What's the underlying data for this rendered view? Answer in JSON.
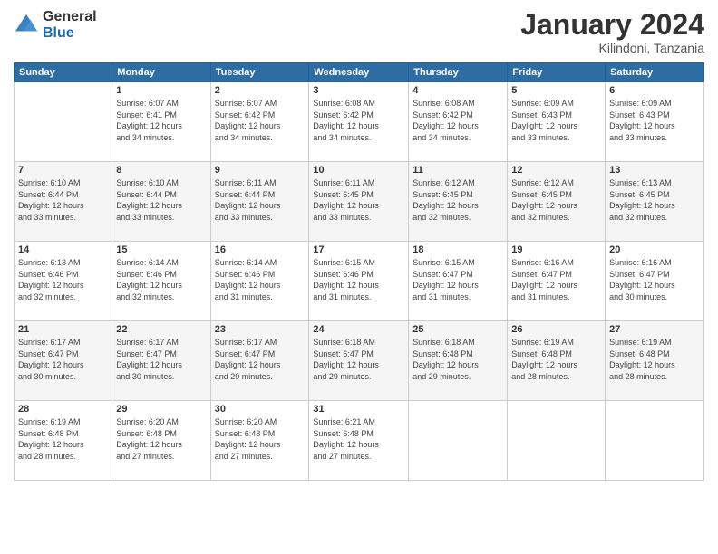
{
  "header": {
    "logo": {
      "general": "General",
      "blue": "Blue"
    },
    "title": "January 2024",
    "subtitle": "Kilindoni, Tanzania"
  },
  "days_of_week": [
    "Sunday",
    "Monday",
    "Tuesday",
    "Wednesday",
    "Thursday",
    "Friday",
    "Saturday"
  ],
  "weeks": [
    [
      {
        "day": "",
        "info": ""
      },
      {
        "day": "1",
        "info": "Sunrise: 6:07 AM\nSunset: 6:41 PM\nDaylight: 12 hours\nand 34 minutes."
      },
      {
        "day": "2",
        "info": "Sunrise: 6:07 AM\nSunset: 6:42 PM\nDaylight: 12 hours\nand 34 minutes."
      },
      {
        "day": "3",
        "info": "Sunrise: 6:08 AM\nSunset: 6:42 PM\nDaylight: 12 hours\nand 34 minutes."
      },
      {
        "day": "4",
        "info": "Sunrise: 6:08 AM\nSunset: 6:42 PM\nDaylight: 12 hours\nand 34 minutes."
      },
      {
        "day": "5",
        "info": "Sunrise: 6:09 AM\nSunset: 6:43 PM\nDaylight: 12 hours\nand 33 minutes."
      },
      {
        "day": "6",
        "info": "Sunrise: 6:09 AM\nSunset: 6:43 PM\nDaylight: 12 hours\nand 33 minutes."
      }
    ],
    [
      {
        "day": "7",
        "info": "Sunrise: 6:10 AM\nSunset: 6:44 PM\nDaylight: 12 hours\nand 33 minutes."
      },
      {
        "day": "8",
        "info": "Sunrise: 6:10 AM\nSunset: 6:44 PM\nDaylight: 12 hours\nand 33 minutes."
      },
      {
        "day": "9",
        "info": "Sunrise: 6:11 AM\nSunset: 6:44 PM\nDaylight: 12 hours\nand 33 minutes."
      },
      {
        "day": "10",
        "info": "Sunrise: 6:11 AM\nSunset: 6:45 PM\nDaylight: 12 hours\nand 33 minutes."
      },
      {
        "day": "11",
        "info": "Sunrise: 6:12 AM\nSunset: 6:45 PM\nDaylight: 12 hours\nand 32 minutes."
      },
      {
        "day": "12",
        "info": "Sunrise: 6:12 AM\nSunset: 6:45 PM\nDaylight: 12 hours\nand 32 minutes."
      },
      {
        "day": "13",
        "info": "Sunrise: 6:13 AM\nSunset: 6:45 PM\nDaylight: 12 hours\nand 32 minutes."
      }
    ],
    [
      {
        "day": "14",
        "info": "Sunrise: 6:13 AM\nSunset: 6:46 PM\nDaylight: 12 hours\nand 32 minutes."
      },
      {
        "day": "15",
        "info": "Sunrise: 6:14 AM\nSunset: 6:46 PM\nDaylight: 12 hours\nand 32 minutes."
      },
      {
        "day": "16",
        "info": "Sunrise: 6:14 AM\nSunset: 6:46 PM\nDaylight: 12 hours\nand 31 minutes."
      },
      {
        "day": "17",
        "info": "Sunrise: 6:15 AM\nSunset: 6:46 PM\nDaylight: 12 hours\nand 31 minutes."
      },
      {
        "day": "18",
        "info": "Sunrise: 6:15 AM\nSunset: 6:47 PM\nDaylight: 12 hours\nand 31 minutes."
      },
      {
        "day": "19",
        "info": "Sunrise: 6:16 AM\nSunset: 6:47 PM\nDaylight: 12 hours\nand 31 minutes."
      },
      {
        "day": "20",
        "info": "Sunrise: 6:16 AM\nSunset: 6:47 PM\nDaylight: 12 hours\nand 30 minutes."
      }
    ],
    [
      {
        "day": "21",
        "info": "Sunrise: 6:17 AM\nSunset: 6:47 PM\nDaylight: 12 hours\nand 30 minutes."
      },
      {
        "day": "22",
        "info": "Sunrise: 6:17 AM\nSunset: 6:47 PM\nDaylight: 12 hours\nand 30 minutes."
      },
      {
        "day": "23",
        "info": "Sunrise: 6:17 AM\nSunset: 6:47 PM\nDaylight: 12 hours\nand 29 minutes."
      },
      {
        "day": "24",
        "info": "Sunrise: 6:18 AM\nSunset: 6:47 PM\nDaylight: 12 hours\nand 29 minutes."
      },
      {
        "day": "25",
        "info": "Sunrise: 6:18 AM\nSunset: 6:48 PM\nDaylight: 12 hours\nand 29 minutes."
      },
      {
        "day": "26",
        "info": "Sunrise: 6:19 AM\nSunset: 6:48 PM\nDaylight: 12 hours\nand 28 minutes."
      },
      {
        "day": "27",
        "info": "Sunrise: 6:19 AM\nSunset: 6:48 PM\nDaylight: 12 hours\nand 28 minutes."
      }
    ],
    [
      {
        "day": "28",
        "info": "Sunrise: 6:19 AM\nSunset: 6:48 PM\nDaylight: 12 hours\nand 28 minutes."
      },
      {
        "day": "29",
        "info": "Sunrise: 6:20 AM\nSunset: 6:48 PM\nDaylight: 12 hours\nand 27 minutes."
      },
      {
        "day": "30",
        "info": "Sunrise: 6:20 AM\nSunset: 6:48 PM\nDaylight: 12 hours\nand 27 minutes."
      },
      {
        "day": "31",
        "info": "Sunrise: 6:21 AM\nSunset: 6:48 PM\nDaylight: 12 hours\nand 27 minutes."
      },
      {
        "day": "",
        "info": ""
      },
      {
        "day": "",
        "info": ""
      },
      {
        "day": "",
        "info": ""
      }
    ]
  ]
}
